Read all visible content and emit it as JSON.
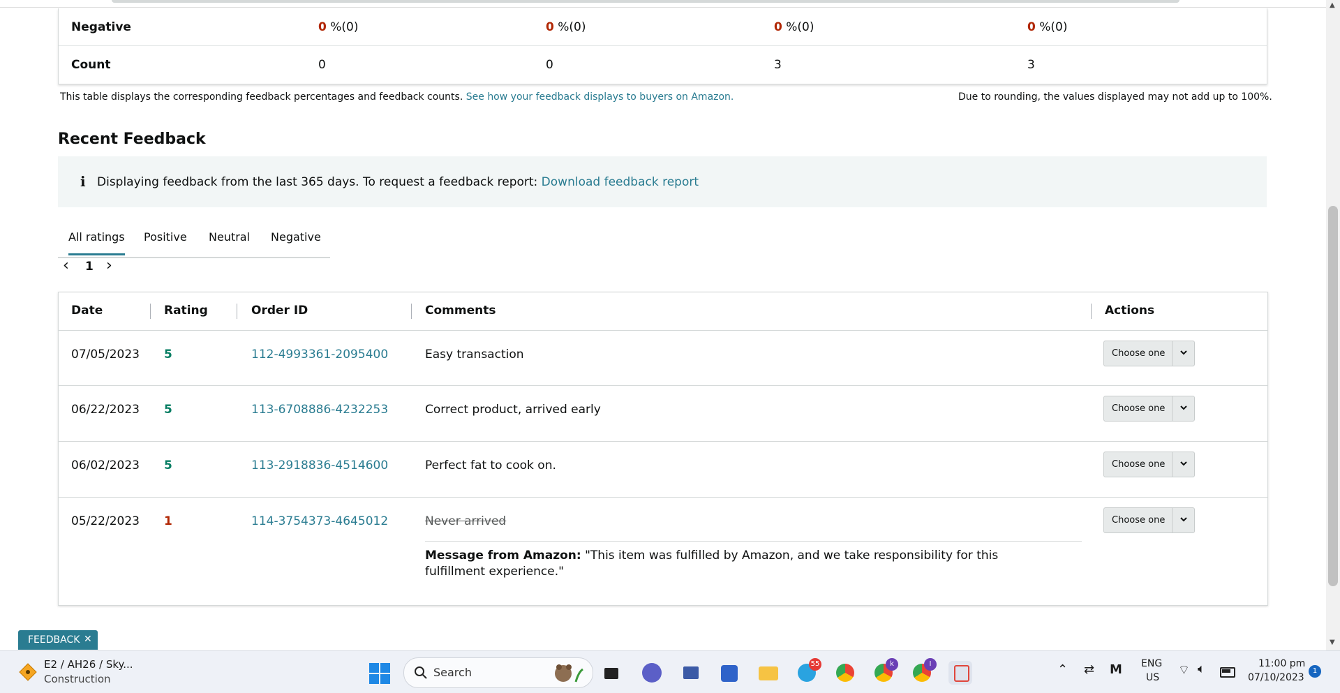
{
  "summary": {
    "rows": [
      {
        "label": "Negative",
        "cells": [
          {
            "pct": "0",
            "rest": " %(0)"
          },
          {
            "pct": "0",
            "rest": " %(0)"
          },
          {
            "pct": "0",
            "rest": " %(0)"
          },
          {
            "pct": "0",
            "rest": " %(0)"
          }
        ]
      },
      {
        "label": "Count",
        "cells": [
          "0",
          "0",
          "3",
          "3"
        ]
      }
    ],
    "note_text": "This table displays the corresponding feedback percentages and feedback counts. ",
    "note_link": "See how your feedback displays to buyers on Amazon.",
    "note_right": "Due to rounding, the values displayed may not add up to 100%."
  },
  "recent": {
    "heading": "Recent Feedback",
    "info_icon": "i",
    "info_text": "Displaying feedback from the last 365 days. To request a feedback report: ",
    "info_link": "Download feedback report",
    "tabs": [
      "All ratings",
      "Positive",
      "Neutral",
      "Negative"
    ],
    "active_tab": "All ratings",
    "pager": {
      "prev": "‹",
      "page": "1",
      "next": "›"
    },
    "columns": [
      "Date",
      "Rating",
      "Order ID",
      "Comments",
      "Actions"
    ],
    "rows": [
      {
        "date": "07/05/2023",
        "rating": "5",
        "order_id": "112-4993361-2095400",
        "comment": "Easy transaction",
        "action": "Choose one"
      },
      {
        "date": "06/22/2023",
        "rating": "5",
        "order_id": "113-6708886-4232253",
        "comment": "Correct product, arrived early",
        "action": "Choose one"
      },
      {
        "date": "06/02/2023",
        "rating": "5",
        "order_id": "113-2918836-4514600",
        "comment": "Perfect fat to cook on.",
        "action": "Choose one"
      },
      {
        "date": "05/22/2023",
        "rating": "1",
        "order_id": "114-3754373-4645012",
        "comment": "Never arrived",
        "action": "Choose one",
        "message_label": "Message from Amazon:",
        "message_text": " \"This item was fulfilled by Amazon, and we take responsibility for this fulfillment experience.\""
      }
    ]
  },
  "feedback_button": {
    "label": "FEEDBACK",
    "close": "✕"
  },
  "taskbar": {
    "weather_title": "E2 / AH26 / Sky...",
    "weather_sub": "Construction",
    "search_placeholder": "Search",
    "telegram_badge": "55",
    "chrome_k_badge": "k",
    "chrome_i_badge": "I",
    "lang_top": "ENG",
    "lang_bottom": "US",
    "time": "11:00 pm",
    "date": "07/10/2023",
    "notifications": "1"
  },
  "colors": {
    "accent": "#2a7c91",
    "negative": "#b12704",
    "positive": "#067d62"
  }
}
